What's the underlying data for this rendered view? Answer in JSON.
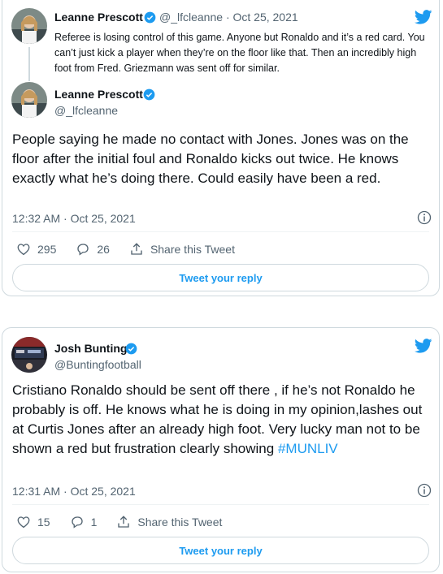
{
  "quoted_tweet": {
    "author_name": "Leanne Prescott",
    "handle": "@_lfcleanne",
    "separator": "·",
    "date": "Oct 25, 2021",
    "text": "Referee is losing control of this game. Anyone but Ronaldo and it’s a red card. You can’t just kick a player when they’re on the floor like that. Then an incredibly high foot from Fred. Griezmann was sent off for similar."
  },
  "tweet1": {
    "author_name": "Leanne Prescott",
    "handle": "@_lfcleanne",
    "text": "People saying he made no contact with Jones. Jones was on the floor after the initial foul and Ronaldo kicks out twice. He knows exactly what he’s doing there. Could easily have been a red.",
    "timestamp": "12:32 AM · Oct 25, 2021",
    "likes": "295",
    "replies": "26",
    "share_label": "Share this Tweet",
    "reply_button": "Tweet your reply"
  },
  "tweet2": {
    "author_name": "Josh Bunting",
    "handle": "@Buntingfootball",
    "text": "Cristiano Ronaldo should be sent off there , if he’s not Ronaldo he probably is off. He knows what he is doing in my opinion,lashes out at Curtis Jones after an already high foot. Very lucky man not to be shown a red but frustration clearly showing ",
    "hashtag": "#MUNLIV",
    "timestamp": "12:31 AM · Oct 25, 2021",
    "likes": "15",
    "replies": "1",
    "share_label": "Share this Tweet",
    "reply_button": "Tweet your reply"
  },
  "colors": {
    "brand": "#1d9bf0",
    "text": "#0f1419",
    "muted": "#536471",
    "border": "#cfd9de"
  },
  "icons": [
    "twitter-bird-icon",
    "verified-badge-icon",
    "info-icon",
    "heart-icon",
    "reply-icon",
    "share-icon"
  ]
}
